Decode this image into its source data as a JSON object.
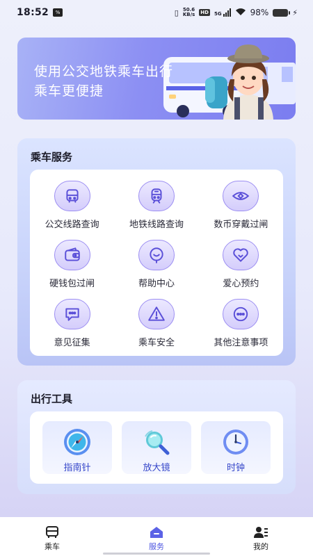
{
  "status": {
    "time": "18:52",
    "speed_value": "50.6",
    "speed_unit": "KB/s",
    "hd_label": "HD",
    "network": "5G",
    "battery": "98%"
  },
  "banner": {
    "line1": "使用公交地铁乘车出行",
    "line2": "乘车更便捷"
  },
  "services": {
    "title": "乘车服务",
    "items": [
      {
        "label": "公交线路查询",
        "icon": "bus-icon"
      },
      {
        "label": "地铁线路查询",
        "icon": "metro-icon"
      },
      {
        "label": "数币穿戴过闸",
        "icon": "eye-icon"
      },
      {
        "label": "硬钱包过闸",
        "icon": "wallet-icon"
      },
      {
        "label": "帮助中心",
        "icon": "help-icon"
      },
      {
        "label": "爱心预约",
        "icon": "heart-icon"
      },
      {
        "label": "意见征集",
        "icon": "feedback-icon"
      },
      {
        "label": "乘车安全",
        "icon": "warning-icon"
      },
      {
        "label": "其他注意事项",
        "icon": "more-icon"
      }
    ]
  },
  "tools": {
    "title": "出行工具",
    "items": [
      {
        "label": "指南针",
        "icon": "compass-icon"
      },
      {
        "label": "放大镜",
        "icon": "magnifier-icon"
      },
      {
        "label": "时钟",
        "icon": "clock-icon"
      }
    ]
  },
  "nav": {
    "items": [
      {
        "label": "乘车",
        "icon": "bus-nav-icon"
      },
      {
        "label": "服务",
        "icon": "home-nav-icon"
      },
      {
        "label": "我的",
        "icon": "profile-nav-icon"
      }
    ],
    "active": "服务"
  },
  "colors": {
    "accent": "#4d55e0",
    "icon_border": "#9c8ef2",
    "tool_label": "#3546c9"
  }
}
